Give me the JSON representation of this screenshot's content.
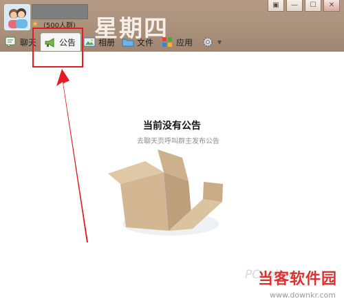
{
  "header": {
    "member_count": "(500人群)",
    "watermark_date": "星期四"
  },
  "window_controls": [
    "▣",
    "—",
    "☐",
    "✕"
  ],
  "tabs": [
    {
      "label": "聊天",
      "icon": "chat-icon"
    },
    {
      "label": "公告",
      "icon": "megaphone-icon",
      "selected": true
    },
    {
      "label": "相册",
      "icon": "photo-icon"
    },
    {
      "label": "文件",
      "icon": "folder-icon"
    },
    {
      "label": "应用",
      "icon": "apps-icon"
    }
  ],
  "empty_state": {
    "title": "当前没有公告",
    "subtitle": "去聊天页呼叫群主发布公告"
  },
  "watermarks": {
    "pconline": "PConline",
    "brand": "当客软件园",
    "url": "www.downkr.com"
  },
  "colors": {
    "titlebar": "#a9907b",
    "highlight": "#e31c24",
    "content_bg": "#ffffff"
  }
}
